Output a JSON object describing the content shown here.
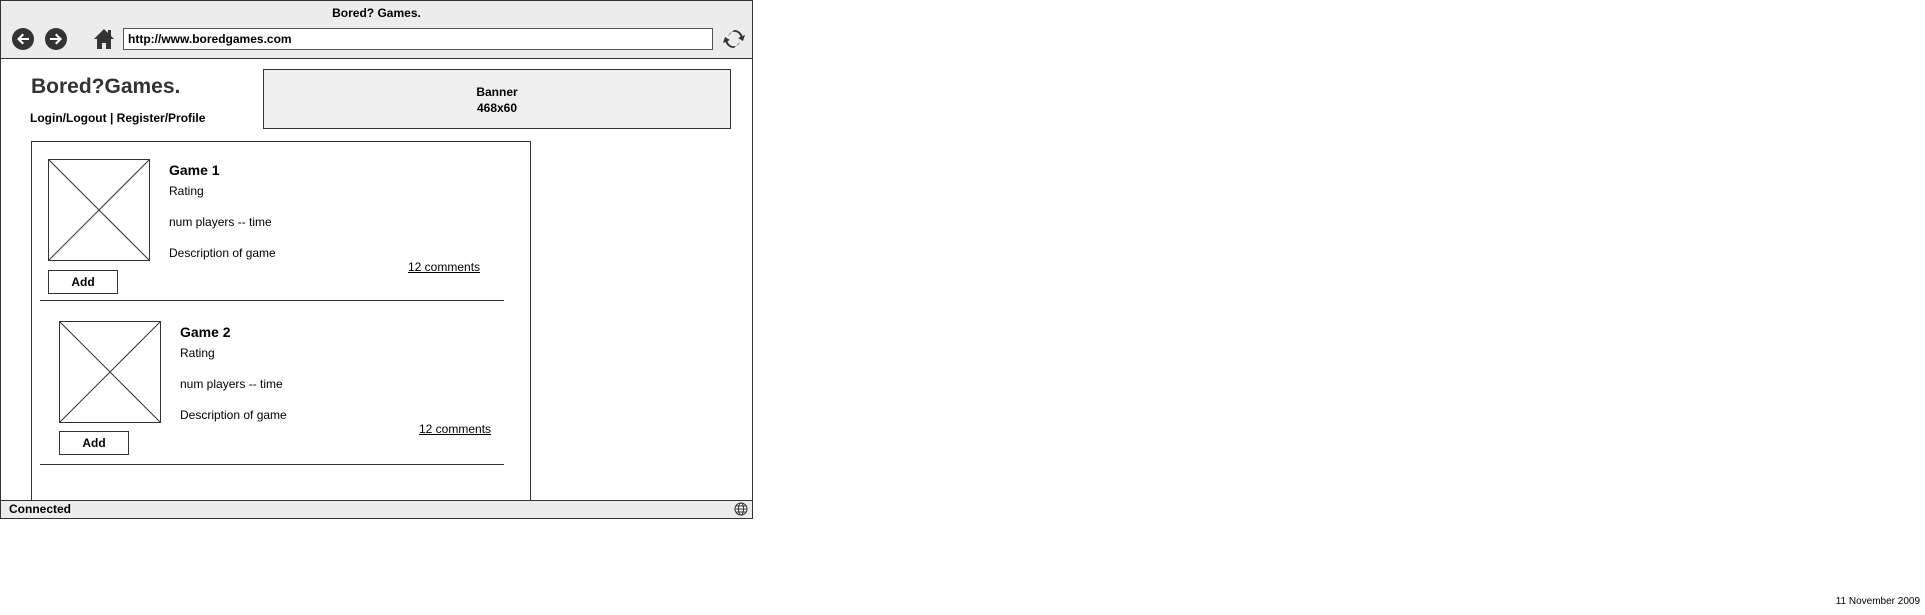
{
  "window": {
    "title": "Bored? Games."
  },
  "toolbar": {
    "back_icon": "arrow-left-circle",
    "forward_icon": "arrow-right-circle",
    "home_icon": "home",
    "refresh_icon": "refresh-arrows",
    "url": "http://www.boredgames.com"
  },
  "site": {
    "logo": "Bored?Games.",
    "login_label": "Login/Logout",
    "separator": " | ",
    "register_label": "Register/Profile"
  },
  "banner": {
    "line1": "Banner",
    "line2": "468x60"
  },
  "games": [
    {
      "title": "Game 1",
      "rating": "Rating",
      "players_time": "num players -- time",
      "description": "Description of game",
      "comments": "12 comments",
      "add_label": "Add"
    },
    {
      "title": "Game 2",
      "rating": "Rating",
      "players_time": "num players -- time",
      "description": "Description of game",
      "comments": "12 comments",
      "add_label": "Add"
    }
  ],
  "statusbar": {
    "text": "Connected",
    "icon": "globe"
  },
  "footer": {
    "date": "11 November 2009"
  },
  "colors": {
    "chrome": "#ececec",
    "border": "#333333",
    "banner": "#efefef"
  }
}
